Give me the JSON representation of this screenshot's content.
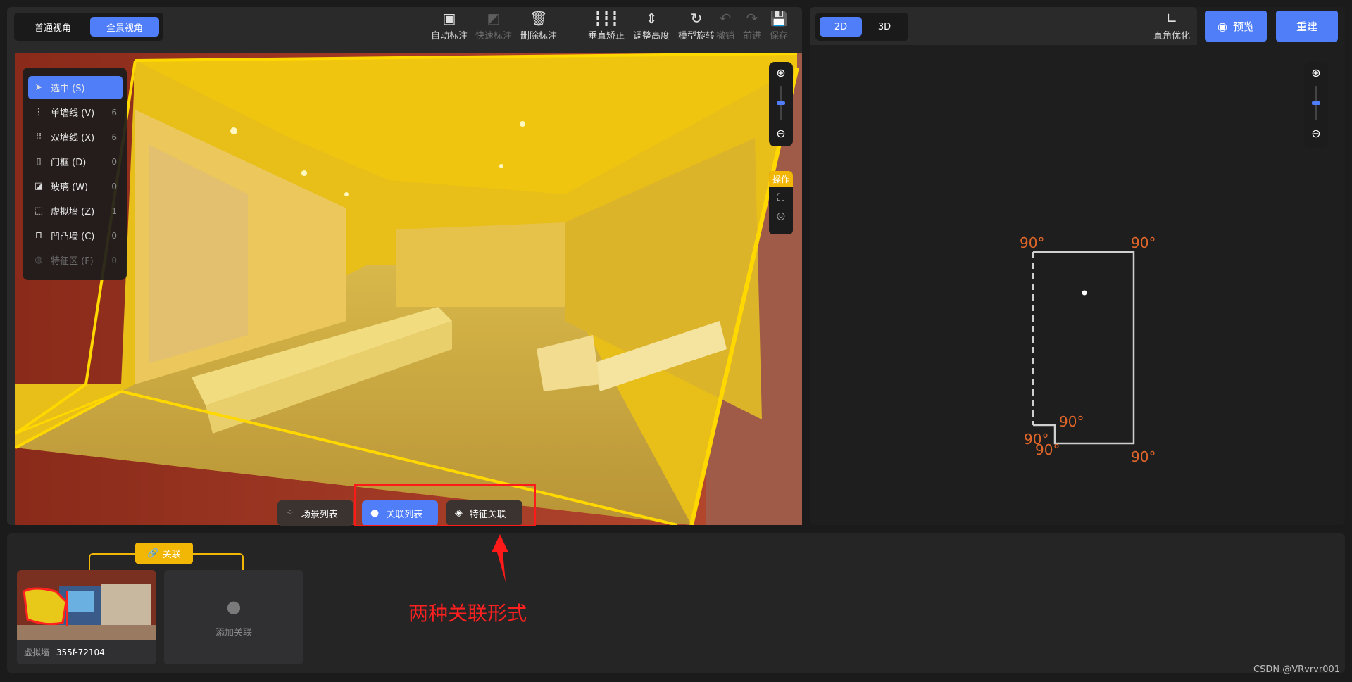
{
  "left_toolbar": {
    "view_modes": [
      {
        "label": "普通视角",
        "active": false
      },
      {
        "label": "全景视角",
        "active": true
      }
    ],
    "tools": [
      {
        "label": "自动标注",
        "icon": "auto-annotate-icon",
        "enabled": true
      },
      {
        "label": "快速标注",
        "icon": "quick-annotate-icon",
        "enabled": false
      },
      {
        "label": "删除标注",
        "icon": "trash-icon",
        "enabled": true
      },
      {
        "label": "垂直矫正",
        "icon": "vertical-correct-icon",
        "enabled": true
      },
      {
        "label": "调整高度",
        "icon": "height-adjust-icon",
        "enabled": true
      },
      {
        "label": "模型旋转",
        "icon": "rotate-icon",
        "enabled": true
      },
      {
        "label": "撤销",
        "icon": "undo-icon",
        "enabled": false
      },
      {
        "label": "前进",
        "icon": "redo-icon",
        "enabled": false
      },
      {
        "label": "保存",
        "icon": "save-icon",
        "enabled": false
      }
    ]
  },
  "annotation_types": [
    {
      "label": "选中 (S)",
      "count": "",
      "active": true,
      "icon": "cursor-icon"
    },
    {
      "label": "单墙线 (V)",
      "count": "6",
      "active": false,
      "icon": "single-wall-icon"
    },
    {
      "label": "双墙线 (X)",
      "count": "6",
      "active": false,
      "icon": "double-wall-icon"
    },
    {
      "label": "门框 (D)",
      "count": "0",
      "active": false,
      "icon": "door-icon"
    },
    {
      "label": "玻璃 (W)",
      "count": "0",
      "active": false,
      "icon": "glass-icon"
    },
    {
      "label": "虚拟墙 (Z)",
      "count": "1",
      "active": false,
      "icon": "virtual-wall-icon"
    },
    {
      "label": "凹凸墙 (C)",
      "count": "0",
      "active": false,
      "icon": "bump-wall-icon"
    },
    {
      "label": "特征区 (F)",
      "count": "0",
      "active": false,
      "dim": true,
      "icon": "feature-area-icon"
    }
  ],
  "viewport": {
    "ops_label": "操作",
    "bottom_buttons": [
      {
        "label": "场景列表",
        "active": false,
        "icon": "scene-list-icon"
      },
      {
        "label": "关联列表",
        "active": true,
        "icon": "link-list-icon"
      },
      {
        "label": "特征关联",
        "active": false,
        "icon": "feature-link-icon"
      }
    ]
  },
  "right_toolbar": {
    "dimension_modes": [
      {
        "label": "2D",
        "active": true
      },
      {
        "label": "3D",
        "active": false
      }
    ],
    "right_angle_label": "直角优化",
    "preview_label": "预览",
    "rebuild_label": "重建"
  },
  "floorplan": {
    "angle_labels": [
      "90°",
      "90°",
      "90°",
      "90°",
      "90°",
      "90°"
    ]
  },
  "bottom": {
    "association_badge": "关联",
    "card_type": "虚拟墙",
    "card_id": "355f-72104",
    "add_label": "添加关联"
  },
  "overlay_annotation": "两种关联形式",
  "watermark": "CSDN @VRvrvr001",
  "colors": {
    "accent": "#4f7ef8",
    "highlight": "#f2b705",
    "angle_label": "#e0662a",
    "callout": "#ff2020"
  }
}
